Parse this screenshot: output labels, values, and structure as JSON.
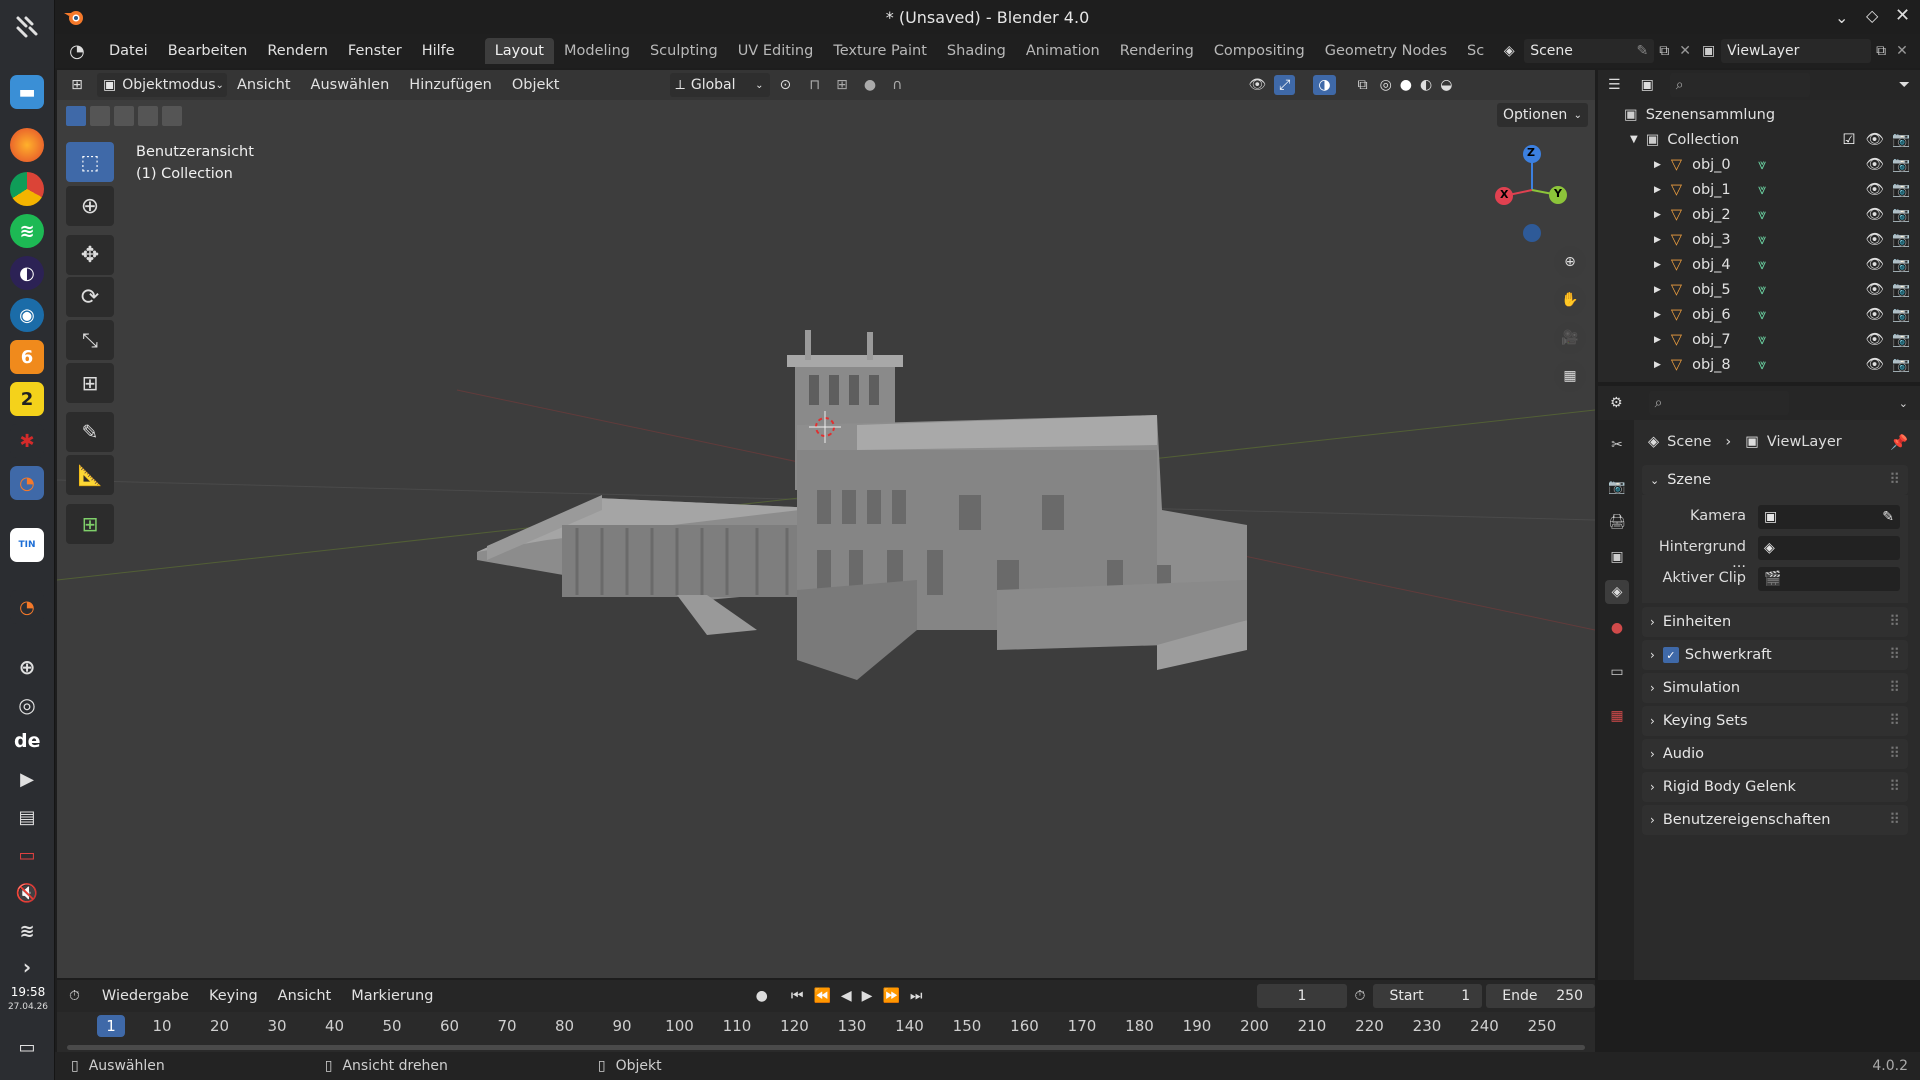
{
  "window": {
    "title": "* (Unsaved) - Blender 4.0"
  },
  "menubar": {
    "items": [
      "Datei",
      "Bearbeiten",
      "Rendern",
      "Fenster",
      "Hilfe"
    ],
    "workspaces": [
      "Layout",
      "Modeling",
      "Sculpting",
      "UV Editing",
      "Texture Paint",
      "Shading",
      "Animation",
      "Rendering",
      "Compositing",
      "Geometry Nodes",
      "Sc"
    ],
    "scene_value": "Scene",
    "viewlayer_value": "ViewLayer"
  },
  "viewport": {
    "mode": "Objektmodus",
    "menus": [
      "Ansicht",
      "Auswählen",
      "Hinzufügen",
      "Objekt"
    ],
    "transform_orientation": "Global",
    "options_label": "Optionen",
    "overlay_title": "Benutzeransicht",
    "overlay_subtitle": "(1) Collection",
    "axes": {
      "x": "X",
      "y": "Y",
      "z": "Z"
    },
    "colors": {
      "x_axis": "#e04150",
      "y_axis": "#8cc43a",
      "z_axis": "#3c80e0",
      "active_tool": "#3f69a8"
    }
  },
  "outliner": {
    "root": "Szenensammlung",
    "collection": "Collection",
    "objects": [
      "obj_0",
      "obj_1",
      "obj_2",
      "obj_3",
      "obj_4",
      "obj_5",
      "obj_6",
      "obj_7",
      "obj_8"
    ]
  },
  "properties": {
    "breadcrumb_scene": "Scene",
    "breadcrumb_viewlayer": "ViewLayer",
    "section": "Szene",
    "fields": [
      "Kamera",
      "Hintergrund ...",
      "Aktiver Clip"
    ],
    "panels": [
      "Einheiten",
      "Schwerkraft",
      "Simulation",
      "Keying Sets",
      "Audio",
      "Rigid Body Gelenk",
      "Benutzereigenschaften"
    ]
  },
  "timeline": {
    "menus": [
      "Wiedergabe",
      "Keying",
      "Ansicht",
      "Markierung"
    ],
    "current_frame": "1",
    "start_label": "Start",
    "start_value": "1",
    "end_label": "Ende",
    "end_value": "250",
    "ticks": [
      "1",
      "10",
      "20",
      "30",
      "40",
      "50",
      "60",
      "70",
      "80",
      "90",
      "100",
      "110",
      "120",
      "130",
      "140",
      "150",
      "160",
      "170",
      "180",
      "190",
      "200",
      "210",
      "220",
      "230",
      "240",
      "250"
    ]
  },
  "statusbar": {
    "select": "Auswählen",
    "rotate": "Ansicht drehen",
    "object": "Objekt",
    "version": "4.0.2"
  },
  "system": {
    "time": "19:58",
    "date": "27.04.26",
    "lang": "de"
  }
}
